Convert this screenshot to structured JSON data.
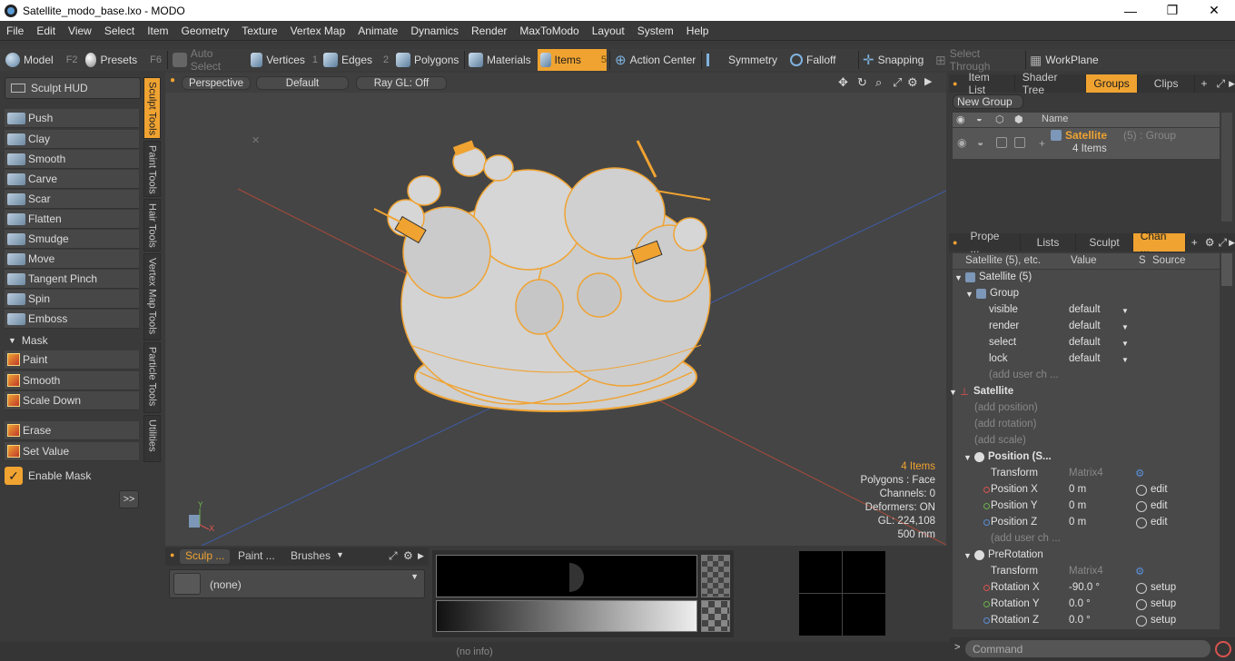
{
  "window": {
    "title": "Satellite_modo_base.lxo - MODO",
    "controls": [
      "—",
      "❐",
      "✕"
    ]
  },
  "menu": [
    "File",
    "Edit",
    "View",
    "Select",
    "Item",
    "Geometry",
    "Texture",
    "Vertex Map",
    "Animate",
    "Dynamics",
    "Render",
    "MaxToModo",
    "Layout",
    "System",
    "Help"
  ],
  "toolbar": {
    "model": "Model",
    "model_key": "F2",
    "presets": "Presets",
    "presets_key": "F6",
    "auto_select": "Auto Select",
    "vertices": "Vertices",
    "vertices_key": "1",
    "edges": "Edges",
    "edges_key": "2",
    "polygons": "Polygons",
    "materials": "Materials",
    "items": "Items",
    "items_key": "5",
    "action_center": "Action Center",
    "symmetry": "Symmetry",
    "falloff": "Falloff",
    "snapping": "Snapping",
    "select_through": "Select Through",
    "workplane": "WorkPlane"
  },
  "left": {
    "sculpt_hud": "Sculpt HUD",
    "vtabs": [
      "Sculpt Tools",
      "Paint Tools",
      "Hair Tools",
      "Vertex Map Tools",
      "Particle Tools",
      "Utilities"
    ],
    "tools": [
      "Push",
      "Clay",
      "Smooth",
      "Carve",
      "Scar",
      "Flatten",
      "Smudge",
      "Move",
      "Tangent Pinch",
      "Spin",
      "Emboss"
    ],
    "mask_header": "Mask",
    "mask_tools": [
      "Paint",
      "Smooth",
      "Scale Down"
    ],
    "erase": "Erase",
    "set_value": "Set Value",
    "enable_mask": "Enable Mask",
    "expand": ">>"
  },
  "viewport": {
    "perspective": "Perspective",
    "default": "Default",
    "raygl": "Ray GL: Off",
    "info": {
      "items": "4 Items",
      "polygons": "Polygons : Face",
      "channels": "Channels: 0",
      "deformers": "Deformers: ON",
      "gl": "GL: 224,108",
      "scale": "500 mm"
    }
  },
  "bottom": {
    "tabs": [
      "Sculp ...",
      "Paint ...",
      "Brushes"
    ],
    "preset_value": "(none)"
  },
  "status": "(no info)",
  "right": {
    "tabs_top": [
      "Item List",
      "Shader Tree",
      "Groups",
      "Clips"
    ],
    "new_group": "New Group",
    "group_col_name": "Name",
    "group_name": "Satellite",
    "group_meta": "(5) : Group",
    "group_items": "4 Items",
    "tabs_mid": [
      "Prope ...",
      "Lists",
      "Sculpt",
      "Chan ..."
    ],
    "chan_cols": {
      "name": "Satellite (5), etc.",
      "value": "Value",
      "s": "S",
      "source": "Source"
    },
    "rows": [
      {
        "name": "Satellite (5)",
        "value": "",
        "src": ""
      },
      {
        "name": "Group",
        "value": "",
        "src": ""
      },
      {
        "name": "visible",
        "value": "default",
        "src": ""
      },
      {
        "name": "render",
        "value": "default",
        "src": ""
      },
      {
        "name": "select",
        "value": "default",
        "src": ""
      },
      {
        "name": "lock",
        "value": "default",
        "src": ""
      },
      {
        "name": "(add user ch ...",
        "value": "",
        "src": ""
      },
      {
        "name": "Satellite",
        "value": "",
        "src": ""
      },
      {
        "name": "(add position)",
        "value": "",
        "src": ""
      },
      {
        "name": "(add rotation)",
        "value": "",
        "src": ""
      },
      {
        "name": "(add scale)",
        "value": "",
        "src": ""
      },
      {
        "name": "Position (S...",
        "value": "",
        "src": ""
      },
      {
        "name": "Transform",
        "value": "Matrix4",
        "src": ""
      },
      {
        "name": "Position X",
        "value": "0 m",
        "src": "edit"
      },
      {
        "name": "Position Y",
        "value": "0 m",
        "src": "edit"
      },
      {
        "name": "Position Z",
        "value": "0 m",
        "src": "edit"
      },
      {
        "name": "(add user ch ...",
        "value": "",
        "src": ""
      },
      {
        "name": "PreRotation",
        "value": "",
        "src": ""
      },
      {
        "name": "Transform",
        "value": "Matrix4",
        "src": ""
      },
      {
        "name": "Rotation X",
        "value": "-90.0 °",
        "src": "setup"
      },
      {
        "name": "Rotation Y",
        "value": "0.0 °",
        "src": "setup"
      },
      {
        "name": "Rotation Z",
        "value": "0.0 °",
        "src": "setup"
      }
    ],
    "command_placeholder": "Command"
  },
  "colors": {
    "accent": "#f0a331",
    "panel": "#3a3a3a",
    "viewport": "#454545"
  }
}
